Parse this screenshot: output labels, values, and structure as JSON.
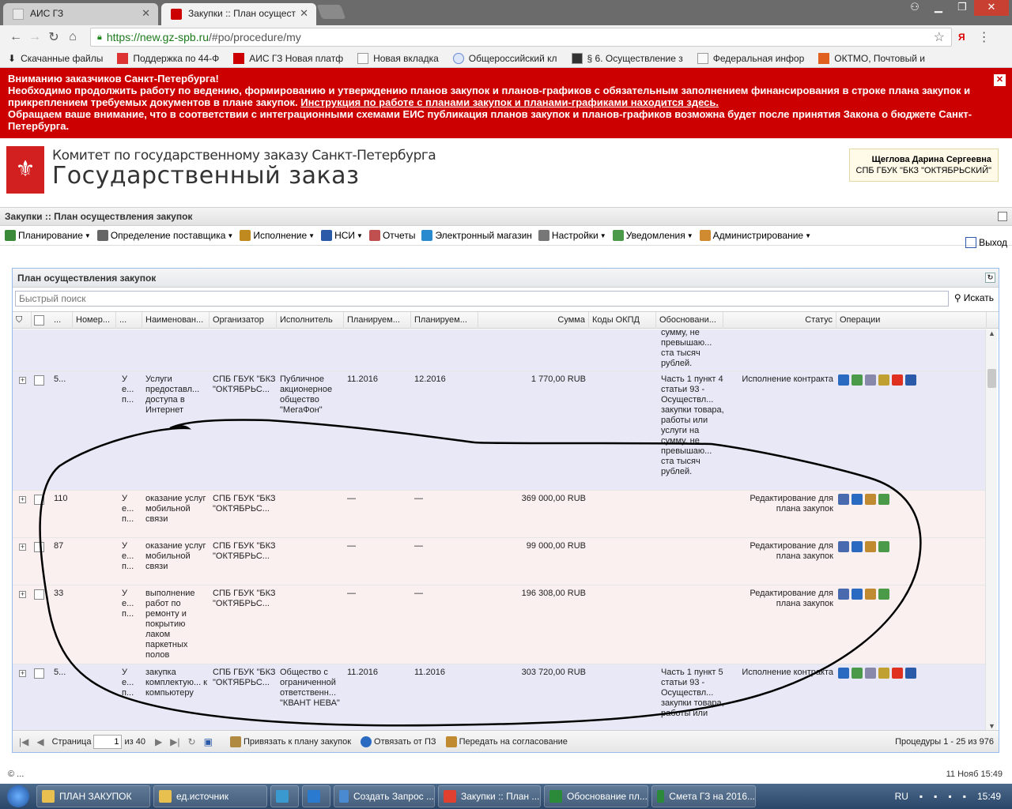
{
  "browser": {
    "tabs": [
      {
        "label": "АИС ГЗ"
      },
      {
        "label": "Закупки :: План осущест"
      }
    ],
    "url_host": "https://new.gz-spb.ru",
    "url_path": "/#po/procedure/my",
    "ext_label": "Я",
    "bookmarks": [
      "Скачанные файлы",
      "Поддержка по 44-Ф",
      "АИС ГЗ Новая платф",
      "Новая вкладка",
      "Общероссийский кл",
      "§ 6. Осуществление з",
      "Федеральная инфор",
      "ОКТМО, Почтовый и"
    ]
  },
  "alert": {
    "line1": "Вниманию заказчиков Санкт-Петербурга!",
    "line2": "Необходимо продолжить работу по ведению, формированию и утверждению планов закупок и планов-графиков с обязательным заполнением финансирования в строке плана закупок и прикреплением требуемых документов в плане закупок.",
    "link": "Инструкция по работе с планами закупок и планами-графиками находится здесь.",
    "line3": "Обращаем ваше внимание, что в соответствии с интеграционными схемами ЕИС публикация планов закупок и планов-графиков возможна будет после принятия Закона о бюджете Санкт-Петербурга."
  },
  "header": {
    "org_line1": "Комитет по государственному заказу Санкт-Петербурга",
    "org_line2": "Государственный заказ",
    "user_name": "Щеглова Дарина Сергеевна",
    "user_org": "СПБ ГБУК \"БКЗ \"ОКТЯБРЬСКИЙ\""
  },
  "page_title": "Закупки :: План осуществления закупок",
  "menu": [
    {
      "label": "Планирование",
      "dd": true,
      "color": "#3a8a3a"
    },
    {
      "label": "Определение поставщика",
      "dd": true,
      "color": "#666666"
    },
    {
      "label": "Исполнение",
      "dd": true,
      "color": "#c08a20"
    },
    {
      "label": "НСИ",
      "dd": true,
      "color": "#2a5aa8"
    },
    {
      "label": "Отчеты",
      "dd": false,
      "color": "#c05050"
    },
    {
      "label": "Электронный магазин",
      "dd": false,
      "color": "#2a8ad0"
    },
    {
      "label": "Настройки",
      "dd": true,
      "color": "#777777"
    },
    {
      "label": "Уведомления",
      "dd": true,
      "color": "#4a9a4a"
    },
    {
      "label": "Администрирование",
      "dd": true,
      "color": "#d08a30"
    }
  ],
  "logout_label": "Выход",
  "panel": {
    "title": "План осуществления закупок",
    "search_placeholder": "Быстрый поиск",
    "search_button": "Искать",
    "columns": [
      "...",
      "Номер...",
      "...",
      "Наименован...",
      "Организатор",
      "Исполнитель",
      "Планируем...",
      "Планируем...",
      "Сумма",
      "Коды ОКПД",
      "Обосновани...",
      "Статус",
      "Операции"
    ],
    "rows": [
      {
        "num": "",
        "x": "",
        "name": "",
        "org": "",
        "exec": "",
        "p1": "",
        "p2": "",
        "sum": "",
        "okpd": "",
        "reason": "сумму, не превышаю... ста тысяч рублей.",
        "status": "",
        "type": "blue",
        "ops": []
      },
      {
        "num": "5...",
        "x": "У е... п...",
        "name": "Услуги предоставл... доступа в Интернет",
        "org": "СПБ ГБУК \"БКЗ \"ОКТЯБРЬС...",
        "exec": "Публичное акционерное общество \"МегаФон\"",
        "p1": "11.2016",
        "p2": "12.2016",
        "sum": "1 770,00 RUB",
        "okpd": "",
        "reason": "Часть 1 пункт 4 статьи 93 - Осуществл... закупки товара, работы или услуги на сумму, не превышаю... ста тысяч рублей.",
        "status": "Исполнение контракта",
        "type": "blue",
        "ops": [
          "#2a6ac0",
          "#4a9a4a",
          "#8888aa",
          "#c0a030",
          "#e03020",
          "#2a5aa8"
        ]
      },
      {
        "num": "110",
        "x": "У е... п...",
        "name": "оказание услуг мобильной связи",
        "org": "СПБ ГБУК \"БКЗ \"ОКТЯБРЬС...",
        "exec": "",
        "p1": "—",
        "p2": "—",
        "sum": "369 000,00 RUB",
        "okpd": "",
        "reason": "",
        "status": "Редактирование для плана закупок",
        "type": "pink",
        "ops": [
          "#4a6ab0",
          "#2a6ac0",
          "#c08a30",
          "#4a9a4a"
        ]
      },
      {
        "num": "87",
        "x": "У е... п...",
        "name": "оказание услуг мобильной связи",
        "org": "СПБ ГБУК \"БКЗ \"ОКТЯБРЬС...",
        "exec": "",
        "p1": "—",
        "p2": "—",
        "sum": "99 000,00 RUB",
        "okpd": "",
        "reason": "",
        "status": "Редактирование для плана закупок",
        "type": "pink",
        "ops": [
          "#4a6ab0",
          "#2a6ac0",
          "#c08a30",
          "#4a9a4a"
        ]
      },
      {
        "num": "33",
        "x": "У е... п...",
        "name": "выполнение работ по ремонту и покрытию лаком паркетных полов",
        "org": "СПБ ГБУК \"БКЗ \"ОКТЯБРЬС...",
        "exec": "",
        "p1": "—",
        "p2": "—",
        "sum": "196 308,00 RUB",
        "okpd": "",
        "reason": "",
        "status": "Редактирование для плана закупок",
        "type": "pink",
        "ops": [
          "#4a6ab0",
          "#2a6ac0",
          "#c08a30",
          "#4a9a4a"
        ]
      },
      {
        "num": "5...",
        "x": "У е... п...",
        "name": "закупка комплектую... к компьютеру",
        "org": "СПБ ГБУК \"БКЗ \"ОКТЯБРЬС...",
        "exec": "Общество с ограниченной ответственн... \"КВАНТ НЕВА\"",
        "p1": "11.2016",
        "p2": "11.2016",
        "sum": "303 720,00 RUB",
        "okpd": "",
        "reason": "Часть 1 пункт 5 статьи 93 - Осуществл... закупки товара, работы или",
        "status": "Исполнение контракта",
        "type": "blue",
        "ops": [
          "#2a6ac0",
          "#4a9a4a",
          "#8888aa",
          "#c0a030",
          "#e03020",
          "#2a5aa8"
        ]
      }
    ],
    "pager": {
      "page_label": "Страница",
      "page_value": "1",
      "of_label": "из 40",
      "bind_label": "Привязать к плану закупок",
      "unbind_label": "Отвязать от ПЗ",
      "send_label": "Передать на согласование",
      "info": "Процедуры 1 - 25 из 976"
    }
  },
  "statusbar": {
    "left": "© ...",
    "right": "11 Нояб 15:49"
  },
  "taskbar": {
    "items": [
      {
        "label": "ПЛАН ЗАКУПОК",
        "color": "#e8c050"
      },
      {
        "label": "ед.источник",
        "color": "#e8c050"
      },
      {
        "label": "",
        "color": "#3a9ad0"
      },
      {
        "label": "",
        "color": "#2a7ad0"
      },
      {
        "label": "Создать Запрос ...",
        "color": "#4a8ad0"
      },
      {
        "label": "Закупки :: План ...",
        "color": "#e04030"
      },
      {
        "label": "Обоснование пл...",
        "color": "#2a8a3a"
      },
      {
        "label": "Смета ГЗ на 2016...",
        "color": "#2a8a3a"
      }
    ],
    "lang": "RU",
    "clock": "15:49"
  }
}
